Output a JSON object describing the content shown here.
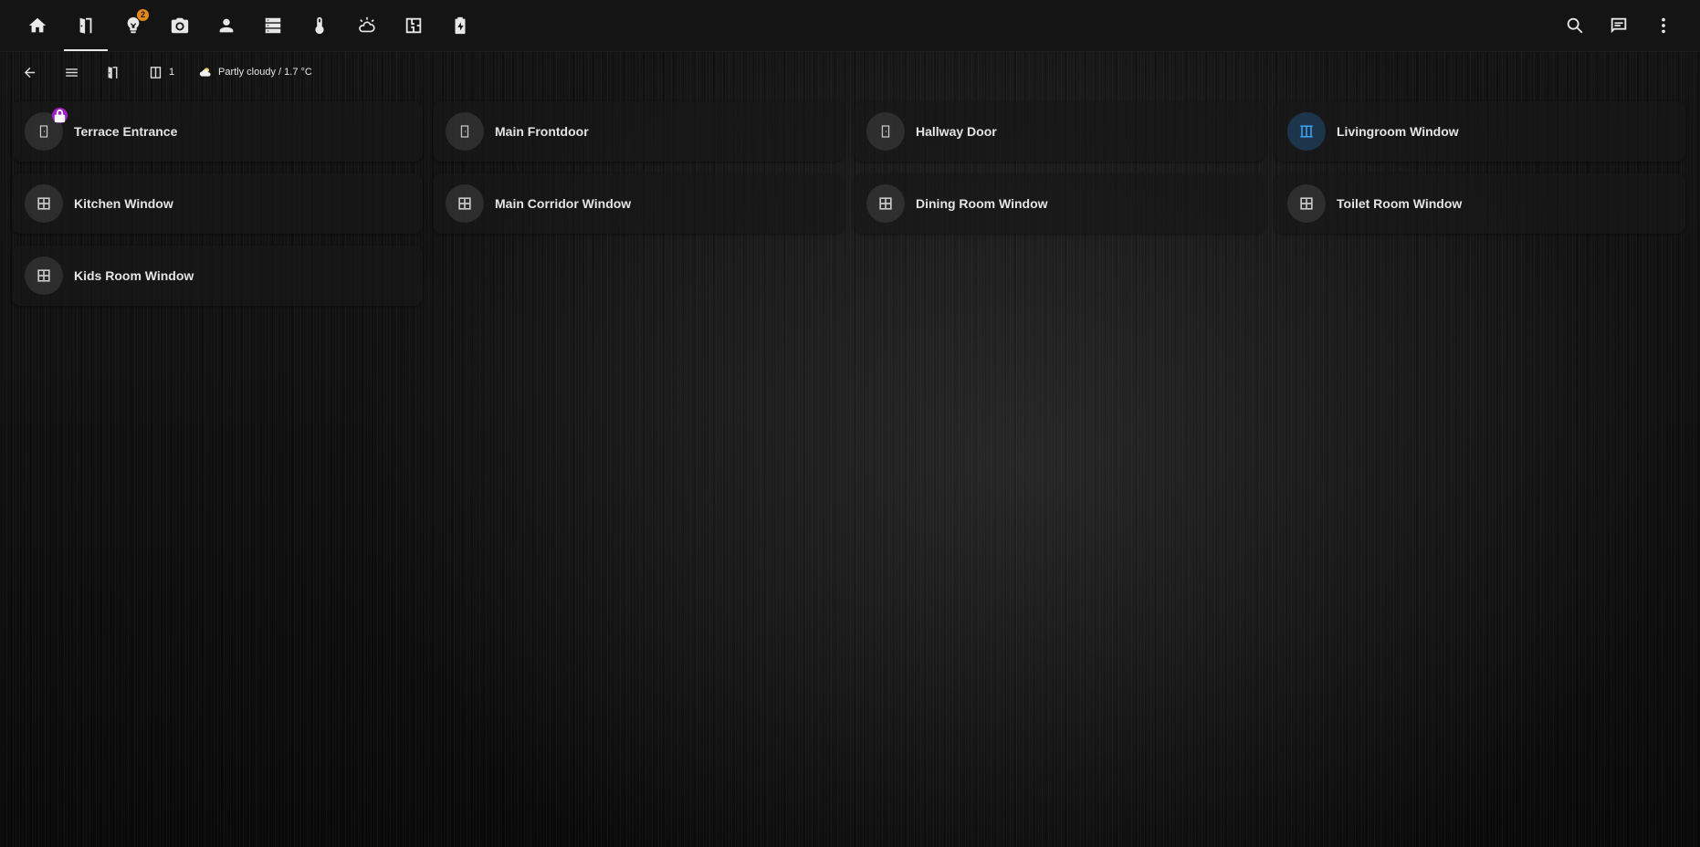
{
  "topbar": {
    "tabs": [
      {
        "name": "home-icon"
      },
      {
        "name": "door-icon",
        "active": true
      },
      {
        "name": "lightbulb-icon",
        "badge": "2"
      },
      {
        "name": "camera-icon"
      },
      {
        "name": "person-icon"
      },
      {
        "name": "server-icon"
      },
      {
        "name": "thermometer-icon"
      },
      {
        "name": "weather-icon"
      },
      {
        "name": "floorplan-icon"
      },
      {
        "name": "battery-charging-icon"
      }
    ],
    "actions": [
      "search-icon",
      "chat-icon",
      "more-vert-icon"
    ],
    "lightbulb_badge": "2"
  },
  "subbar": {
    "window_count": "1",
    "weather_text": "Partly cloudy / 1.7 °C"
  },
  "cards": [
    {
      "label": "Terrace Entrance",
      "icon": "door-icon",
      "locked": true
    },
    {
      "label": "Main Frontdoor",
      "icon": "door-icon"
    },
    {
      "label": "Hallway Door",
      "icon": "door-icon"
    },
    {
      "label": "Livingroom Window",
      "icon": "window-open-icon",
      "active": true
    },
    {
      "label": "Kitchen Window",
      "icon": "window-closed-icon"
    },
    {
      "label": "Main Corridor Window",
      "icon": "window-closed-icon"
    },
    {
      "label": "Dining Room Window",
      "icon": "window-closed-icon"
    },
    {
      "label": "Toilet Room Window",
      "icon": "window-closed-icon"
    },
    {
      "label": "Kids Room Window",
      "icon": "window-closed-icon"
    }
  ],
  "colors": {
    "active_icon": "#3a9be6",
    "inactive_icon": "#c8c8c8",
    "lock_badge": "#a020c8",
    "notification_badge": "#e28a17"
  }
}
